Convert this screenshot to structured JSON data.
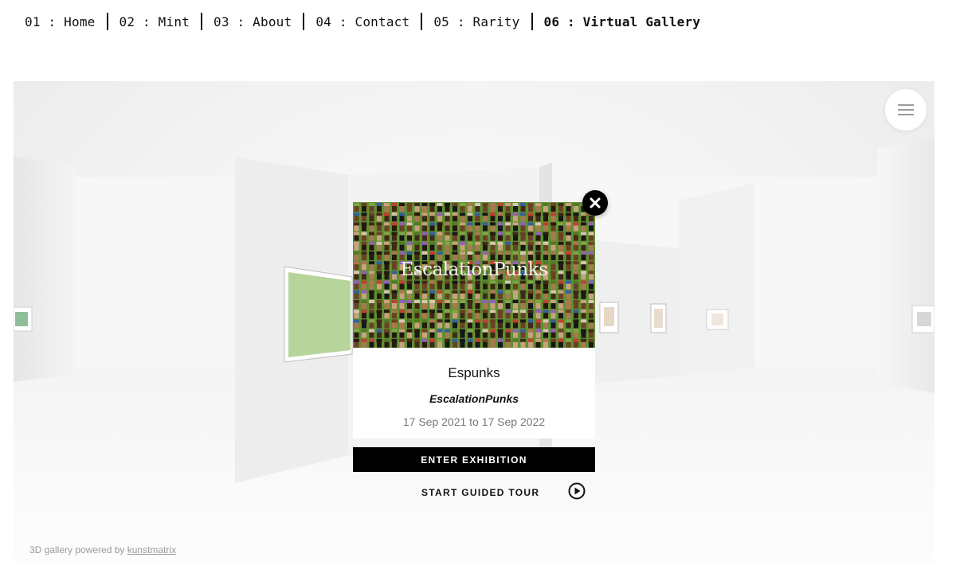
{
  "nav": {
    "items": [
      {
        "label": "01 : Home"
      },
      {
        "label": "02 : Mint"
      },
      {
        "label": "03 : About"
      },
      {
        "label": "04 : Contact"
      },
      {
        "label": "05 : Rarity"
      },
      {
        "label": "06 : Virtual Gallery",
        "active": true
      }
    ]
  },
  "gallery": {
    "menu_icon": "hamburger-menu-icon",
    "powered_prefix": "3D gallery powered by ",
    "powered_link": "kunstmatrix"
  },
  "exhibition": {
    "image_text": "EscalationPunks",
    "title": "Espunks",
    "artist": "EscalationPunks",
    "dates": "17 Sep 2021 to 17 Sep 2022",
    "enter_label": "ENTER EXHIBITION",
    "tour_label": "START GUIDED TOUR",
    "tour_icon": "play-circle-icon",
    "close_icon": "close-icon"
  },
  "colors": {
    "accent": "#000000",
    "gallery_bg": "#f2f2f2",
    "punk_bg": "#6fa33a"
  }
}
